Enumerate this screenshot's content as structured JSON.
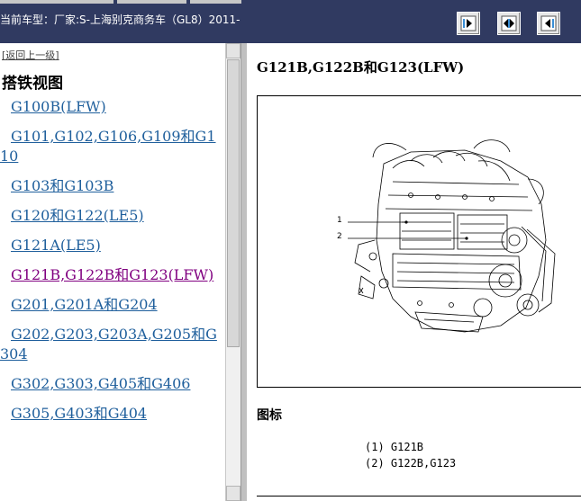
{
  "header": {
    "title": "当前车型：厂家:S-上海别克商务车（GL8）2011-",
    "buttons": [
      {
        "name": "previous-page-icon"
      },
      {
        "name": "contents-icon"
      },
      {
        "name": "next-page-icon"
      }
    ]
  },
  "sidebar": {
    "back_link": "[返回上一级]",
    "section_title": "搭铁视图",
    "items": [
      {
        "label": "G100B(LFW)"
      },
      {
        "label": "G101,G102,G106,G109和G110"
      },
      {
        "label": "G103和G103B"
      },
      {
        "label": "G120和G122(LE5)"
      },
      {
        "label": "G121A(LE5)"
      },
      {
        "label": "G121B,G122B和G123(LFW)",
        "visited": true
      },
      {
        "label": "G201,G201A和G204"
      },
      {
        "label": "G202,G203,G203A,G205和G304"
      },
      {
        "label": "G302,G303,G405和G406"
      },
      {
        "label": "G305,G403和G404"
      }
    ]
  },
  "main": {
    "title": "G121B,G122B和G123(LFW)",
    "figure": {
      "callouts": [
        "1",
        "2"
      ]
    },
    "legend_title": "图标",
    "legend_items": [
      "(1) G121B",
      "(2) G122B,G123"
    ]
  },
  "colors": {
    "header_bg": "#303a61",
    "link": "#1f5f9c",
    "visited_link": "#800080"
  }
}
